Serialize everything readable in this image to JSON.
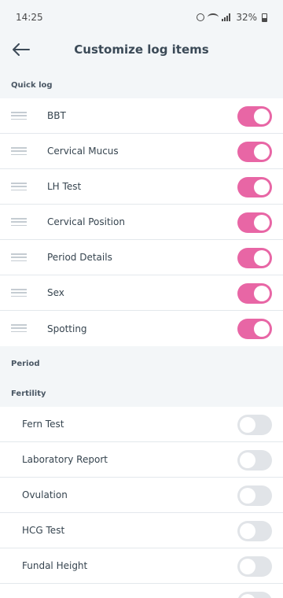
{
  "status_bar": {
    "time": "14:25",
    "battery": "32%"
  },
  "header": {
    "title": "Customize log items",
    "back_icon": "arrow-left-icon"
  },
  "sections": {
    "quick_log": "Quick log",
    "period": "Period",
    "fertility": "Fertility"
  },
  "quick_log_items": [
    {
      "label": "BBT",
      "enabled": true
    },
    {
      "label": "Cervical Mucus",
      "enabled": true
    },
    {
      "label": "LH Test",
      "enabled": true
    },
    {
      "label": "Cervical Position",
      "enabled": true
    },
    {
      "label": "Period Details",
      "enabled": true
    },
    {
      "label": "Sex",
      "enabled": true
    },
    {
      "label": "Spotting",
      "enabled": true
    }
  ],
  "fertility_items": [
    {
      "label": "Fern Test",
      "enabled": false
    },
    {
      "label": "Laboratory Report",
      "enabled": false
    },
    {
      "label": "Ovulation",
      "enabled": false
    },
    {
      "label": "HCG Test",
      "enabled": false
    },
    {
      "label": "Fundal Height",
      "enabled": false
    },
    {
      "label": "",
      "enabled": false
    }
  ],
  "colors": {
    "toggle_on": "#e866a5",
    "toggle_off": "#e1e4e8",
    "background": "#f3f6f8"
  }
}
